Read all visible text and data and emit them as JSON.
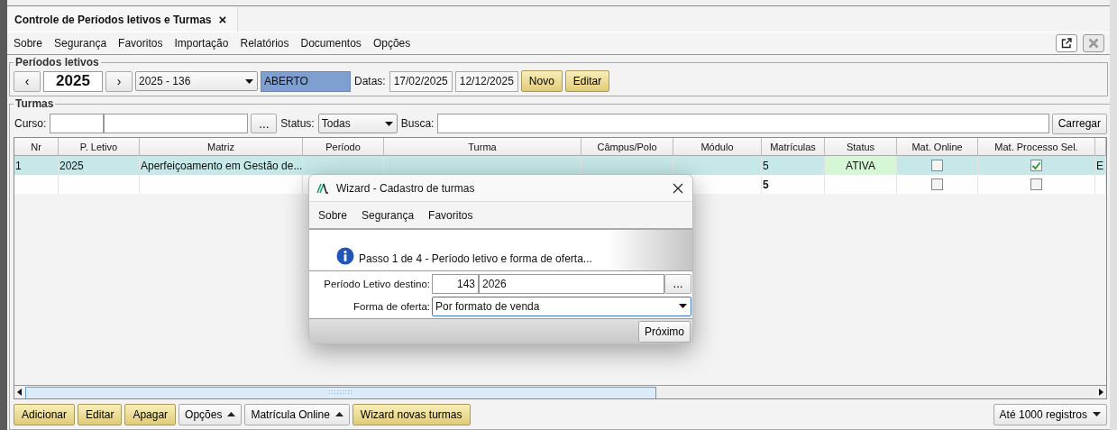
{
  "tab": {
    "title": "Controle de Períodos letivos e Turmas",
    "close": "×"
  },
  "menu": [
    "Sobre",
    "Segurança",
    "Favoritos",
    "Importação",
    "Relatórios",
    "Documentos",
    "Opções"
  ],
  "window_buttons": [
    {
      "kind": "popout",
      "disabled": false
    },
    {
      "kind": "close",
      "disabled": true
    }
  ],
  "periodos": {
    "legend": "Períodos letivos",
    "prev": "‹",
    "year": "2025",
    "next": "›",
    "period_select": "2025 - 136",
    "state": "ABERTO",
    "dates_label": "Datas:",
    "start": "17/02/2025",
    "end": "12/12/2025",
    "buttons": [
      "Novo",
      "Editar"
    ]
  },
  "turmas": {
    "legend": "Turmas",
    "curso_label": "Curso:",
    "browse": "...",
    "status_label": "Status:",
    "status_value": "Todas",
    "busca_label": "Busca:",
    "load": "Carregar",
    "table": {
      "columns": [
        {
          "label": "Nr",
          "kind": "text"
        },
        {
          "label": "P. Letivo",
          "kind": "text"
        },
        {
          "label": "Matriz",
          "kind": "text"
        },
        {
          "label": "Período",
          "kind": "text"
        },
        {
          "label": "Turma",
          "kind": "text"
        },
        {
          "label": "Câmpus/Polo",
          "kind": "text"
        },
        {
          "label": "Módulo",
          "kind": "text"
        },
        {
          "label": "Matrículas",
          "kind": "text"
        },
        {
          "label": "Status",
          "kind": "status"
        },
        {
          "label": "Mat. Online",
          "kind": "check"
        },
        {
          "label": "Mat. Processo Sel.",
          "kind": "check"
        },
        {
          "kind": "text"
        }
      ],
      "rows": [
        {
          "selected": true,
          "kind": "data",
          "cells": [
            "1",
            "2025",
            "Aperfeiçoamento em Gestão de...",
            null,
            null,
            null,
            null,
            "5",
            "ATIVA",
            false,
            true,
            "E"
          ]
        },
        {
          "selected": false,
          "kind": "total",
          "cells": [
            null,
            null,
            null,
            null,
            null,
            null,
            null,
            "5",
            null,
            false,
            false,
            null
          ]
        }
      ]
    },
    "actions": [
      {
        "label": "Adicionar",
        "kind": "action"
      },
      {
        "label": "Editar",
        "kind": "action"
      },
      {
        "label": "Apagar",
        "kind": "action"
      },
      {
        "label": "Opções",
        "kind": "menu"
      },
      {
        "label": "Matrícula Online",
        "kind": "menu"
      },
      {
        "label": "Wizard novas turmas",
        "kind": "action"
      }
    ],
    "limit": "Até 1000 registros"
  },
  "wizard": {
    "title": "Wizard - Cadastro de turmas",
    "menu": [
      "Sobre",
      "Segurança",
      "Favoritos"
    ],
    "step": "Passo 1 de 4 -  Período letivo e forma de oferta...",
    "fields": [
      {
        "kind": "lookup",
        "label": "Período Letivo destino:",
        "code": "143",
        "value": "2026",
        "browse": "..."
      },
      {
        "kind": "select",
        "label": "Forma de oferta:",
        "value": "Por formato de venda"
      }
    ],
    "next": "Próximo"
  }
}
